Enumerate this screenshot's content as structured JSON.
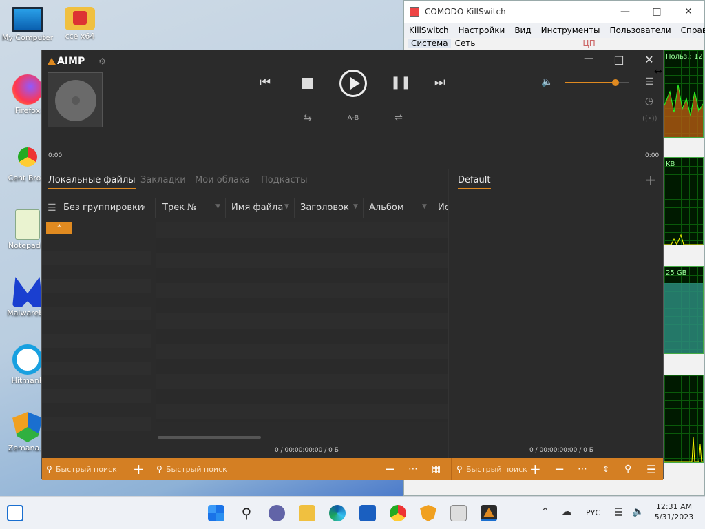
{
  "desktop": {
    "icons": [
      {
        "label": "My Computer"
      },
      {
        "label": "cce x64"
      },
      {
        "label": "Firefox"
      },
      {
        "label": "Cent Brow"
      },
      {
        "label": "Notepad+"
      },
      {
        "label": "Malwareby"
      },
      {
        "label": "HitmanP"
      },
      {
        "label": "Zemana.A"
      }
    ]
  },
  "comodo": {
    "title": "COMODO KillSwitch",
    "menu": [
      "KillSwitch",
      "Настройки",
      "Вид",
      "Инструменты",
      "Пользователи",
      "Справка"
    ],
    "tabs": [
      "Система",
      "Сеть"
    ],
    "tab_extra": "ЦП",
    "graphs": [
      {
        "caption": "Польз.: 12"
      },
      {
        "caption": "KB"
      },
      {
        "caption": "25 GB"
      },
      {
        "caption": ""
      }
    ]
  },
  "aimp": {
    "logo": "AIMP",
    "ab_label": "A-B",
    "time_start": "0:00",
    "time_end": "0:00",
    "volume_fraction": 0.79,
    "tabs": [
      "Локальные файлы",
      "Закладки",
      "Мои облака",
      "Подкасты"
    ],
    "active_tab": "Локальные файлы",
    "playlist_name": "Default",
    "columns": [
      "Без группировки",
      "Трек №",
      "Имя файла",
      "Заголовок",
      "Альбом",
      "Ис"
    ],
    "group_item": "*",
    "status_left": "0 / 00:00:00:00 / 0 Б",
    "status_right": "0 / 00:00:00:00 / 0 Б",
    "search_placeholder": "Быстрый поиск"
  },
  "taskbar": {
    "lang": "РУС",
    "time": "12:31 AM",
    "date": "5/31/2023"
  },
  "colors": {
    "accent": "#d47f23",
    "aimp_bg": "#2b2b2b"
  }
}
